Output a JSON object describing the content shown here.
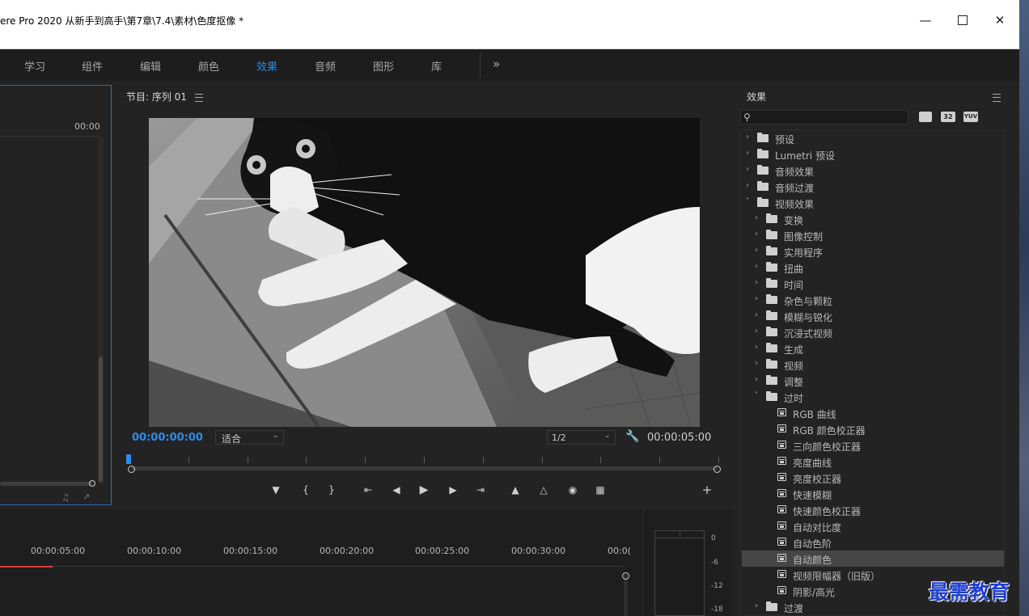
{
  "window": {
    "title": "ere Pro 2020 从新手到高手\\第7章\\7.4\\素材\\色度抠像 *",
    "controls": [
      "minimize",
      "maximize",
      "close"
    ]
  },
  "workspaces": {
    "tabs": [
      {
        "label": "学习"
      },
      {
        "label": "组件"
      },
      {
        "label": "编辑"
      },
      {
        "label": "颜色"
      },
      {
        "label": "效果",
        "active": true
      },
      {
        "label": "音频"
      },
      {
        "label": "图形"
      },
      {
        "label": "库"
      }
    ],
    "more": "»"
  },
  "source_panel": {
    "timecode": "00:00"
  },
  "program_monitor": {
    "title": "节目: 序列 01",
    "current_time": "00:00:00:00",
    "fit": "适合",
    "resolution": "1/2",
    "duration": "00:00:05:00"
  },
  "timeline": {
    "ruler": [
      "00:00:05:00",
      "00:00:10:00",
      "00:00:15:00",
      "00:00:20:00",
      "00:00:25:00",
      "00:00:30:00",
      "00:0("
    ]
  },
  "audio_meter": {
    "labels": [
      "0",
      "-6",
      "-12",
      "-18"
    ]
  },
  "effects_panel": {
    "title": "效果",
    "search_placeholder": "",
    "filter_badges": [
      "32",
      "YUV"
    ],
    "items": [
      {
        "label": "预设",
        "kind": "preset",
        "level": 0,
        "expanded": false
      },
      {
        "label": "Lumetri 预设",
        "kind": "preset",
        "level": 0,
        "expanded": false
      },
      {
        "label": "音频效果",
        "kind": "folder",
        "level": 0,
        "expanded": false
      },
      {
        "label": "音频过渡",
        "kind": "folder",
        "level": 0,
        "expanded": false
      },
      {
        "label": "视频效果",
        "kind": "folder",
        "level": 0,
        "expanded": true
      },
      {
        "label": "变换",
        "kind": "folder",
        "level": 1,
        "expanded": false
      },
      {
        "label": "图像控制",
        "kind": "folder",
        "level": 1,
        "expanded": false
      },
      {
        "label": "实用程序",
        "kind": "folder",
        "level": 1,
        "expanded": false
      },
      {
        "label": "扭曲",
        "kind": "folder",
        "level": 1,
        "expanded": false
      },
      {
        "label": "时间",
        "kind": "folder",
        "level": 1,
        "expanded": false
      },
      {
        "label": "杂色与颗粒",
        "kind": "folder",
        "level": 1,
        "expanded": false
      },
      {
        "label": "模糊与锐化",
        "kind": "folder",
        "level": 1,
        "expanded": false
      },
      {
        "label": "沉浸式视频",
        "kind": "folder",
        "level": 1,
        "expanded": false
      },
      {
        "label": "生成",
        "kind": "folder",
        "level": 1,
        "expanded": false
      },
      {
        "label": "视频",
        "kind": "folder",
        "level": 1,
        "expanded": false
      },
      {
        "label": "调整",
        "kind": "folder",
        "level": 1,
        "expanded": false
      },
      {
        "label": "过时",
        "kind": "folder",
        "level": 1,
        "expanded": true
      },
      {
        "label": "RGB 曲线",
        "kind": "effect",
        "level": 2
      },
      {
        "label": "RGB 颜色校正器",
        "kind": "effect",
        "level": 2
      },
      {
        "label": "三向颜色校正器",
        "kind": "effect",
        "level": 2
      },
      {
        "label": "亮度曲线",
        "kind": "effect",
        "level": 2
      },
      {
        "label": "亮度校正器",
        "kind": "effect",
        "level": 2
      },
      {
        "label": "快速模糊",
        "kind": "effect",
        "level": 2
      },
      {
        "label": "快速颜色校正器",
        "kind": "effect",
        "level": 2
      },
      {
        "label": "自动对比度",
        "kind": "effect",
        "level": 2
      },
      {
        "label": "自动色阶",
        "kind": "effect",
        "level": 2
      },
      {
        "label": "自动颜色",
        "kind": "effect",
        "level": 2,
        "selected": true
      },
      {
        "label": "视频限幅器（旧版）",
        "kind": "effect",
        "level": 2
      },
      {
        "label": "阴影/高光",
        "kind": "effect",
        "level": 2
      },
      {
        "label": "过渡",
        "kind": "folder",
        "level": 1,
        "expanded": false
      }
    ]
  },
  "watermark": "最需教育",
  "colors": {
    "accent": "#2d8ceb",
    "panel_bg": "#232323",
    "selected_row": "#464646",
    "playhead_red": "#e03c3c",
    "watermark": "#1f3fd0"
  }
}
